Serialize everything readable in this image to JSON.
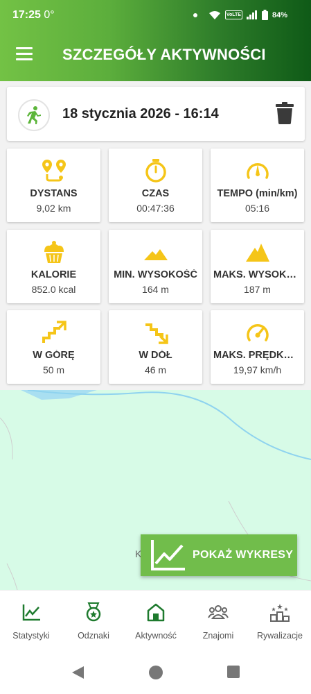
{
  "status_bar": {
    "time": "17:25",
    "extra": "0°",
    "battery": "84%",
    "sim": "VoLTE"
  },
  "header": {
    "title": "SZCZEGÓŁY AKTYWNOŚCI"
  },
  "activity": {
    "datetime": "18 stycznia 2026 - 16:14"
  },
  "stats": [
    {
      "icon": "route-pins-icon",
      "label": "DYSTANS",
      "value": "9,02 km"
    },
    {
      "icon": "stopwatch-icon",
      "label": "CZAS",
      "value": "00:47:36"
    },
    {
      "icon": "gauge-icon",
      "label": "TEMPO (min/km)",
      "value": "05:16"
    },
    {
      "icon": "cupcake-icon",
      "label": "KALORIE",
      "value": "852.0 kcal"
    },
    {
      "icon": "low-mountain-icon",
      "label": "MIN. WYSOKOŚĆ",
      "value": "164 m"
    },
    {
      "icon": "mountain-icon",
      "label": "MAKS. WYSOKOŚĆ",
      "value": "187 m"
    },
    {
      "icon": "stairs-up-icon",
      "label": "W GÓRĘ",
      "value": "50 m"
    },
    {
      "icon": "stairs-down-icon",
      "label": "W DÓŁ",
      "value": "46 m"
    },
    {
      "icon": "speedometer-icon",
      "label": "MAKS. PRĘDKOŚĆ",
      "value": "19,97 km/h"
    }
  ],
  "map": {
    "visible_label": "K"
  },
  "charts_button": {
    "label": "POKAŻ WYKRESY"
  },
  "bottom_nav": [
    {
      "icon": "chart-line-icon",
      "label": "Statystyki"
    },
    {
      "icon": "medal-icon",
      "label": "Odznaki"
    },
    {
      "icon": "home-icon",
      "label": "Aktywność"
    },
    {
      "icon": "friends-icon",
      "label": "Znajomi"
    },
    {
      "icon": "podium-stars-icon",
      "label": "Rywalizacje"
    }
  ],
  "colors": {
    "accent_green": "#71bd4b",
    "dark_green": "#0f5a17",
    "icon_yellow": "#f5c518",
    "map_bg": "#d7fbe7"
  }
}
